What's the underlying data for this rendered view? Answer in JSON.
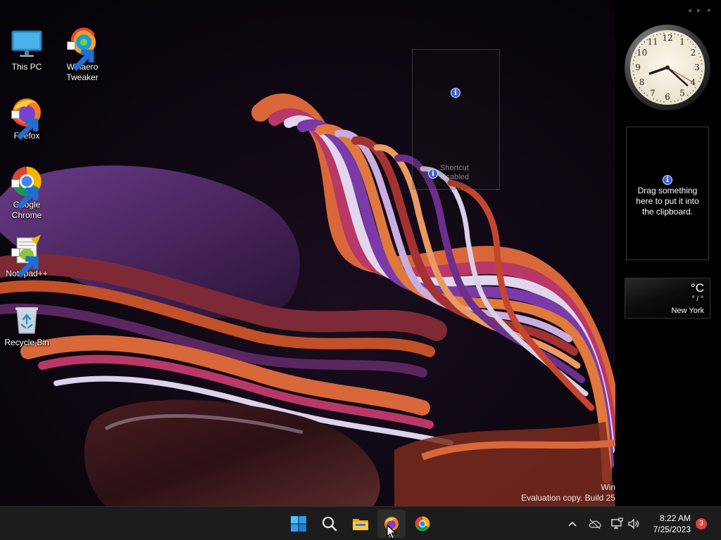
{
  "desktop": {
    "icons": [
      {
        "label": "This PC",
        "icon": "monitor-icon",
        "shortcut": false
      },
      {
        "label": "Winaero\nTweaker",
        "icon": "winaero-tweaker-icon",
        "shortcut": true
      },
      {
        "label": "Firefox",
        "icon": "firefox-icon",
        "shortcut": true
      },
      {
        "label": "Google\nChrome",
        "icon": "chrome-icon",
        "shortcut": true
      },
      {
        "label": "Notepad++",
        "icon": "notepad-plus-plus-icon",
        "shortcut": true
      },
      {
        "label": "Recycle Bin",
        "icon": "recycle-bin-icon",
        "shortcut": false
      }
    ],
    "watermark": {
      "line1": "Win",
      "line2": "Evaluation copy. Build 25"
    },
    "ghost_gadget": {
      "message": "Shortcut\ndisabled"
    }
  },
  "sidebar": {
    "controls": [
      "◂",
      "▸",
      "+"
    ],
    "clock": {
      "hour": 8,
      "minute": 22,
      "second": 20,
      "numerals": [
        "12",
        "1",
        "2",
        "3",
        "4",
        "5",
        "6",
        "7",
        "8",
        "9",
        "10",
        "11"
      ]
    },
    "clipboard": {
      "message": "Drag something here to put it into the clipboard."
    },
    "weather": {
      "unit": "°C",
      "range": "° / °",
      "city": "New York"
    }
  },
  "taskbar": {
    "apps": [
      "start-icon",
      "search-icon",
      "file-explorer-icon",
      "firefox-icon",
      "chrome-icon"
    ],
    "active_app": "firefox-icon",
    "tray": {
      "time": "8:22 AM",
      "date": "7/25/2023",
      "notification_count": "3"
    }
  },
  "colors": {
    "taskbar_bg": "#1c1c1c",
    "badge": "#e0413f",
    "info_blue": "#3b62d6"
  }
}
